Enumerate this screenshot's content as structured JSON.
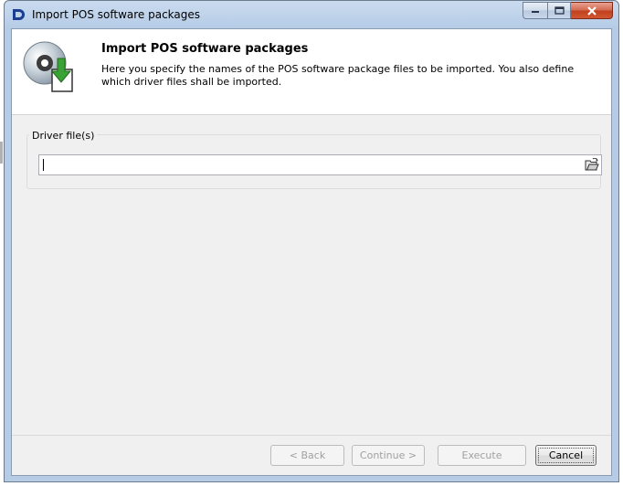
{
  "window": {
    "title": "Import POS software packages",
    "app_icon": "app-d-logo-icon"
  },
  "header": {
    "title": "Import POS software packages",
    "description": "Here you specify the names of the POS software package files to be imported. You also define which driver files shall be imported.",
    "icon": "cd-import-icon"
  },
  "driver_files": {
    "label": "Driver file(s)",
    "value": "",
    "browse_icon": "open-folder-icon"
  },
  "buttons": {
    "back": "< Back",
    "continue": "Continue >",
    "execute": "Execute",
    "cancel": "Cancel"
  },
  "colors": {
    "title_bar": "#b6cce6",
    "close_button": "#c2401f",
    "client_background": "#f0f0f0"
  }
}
